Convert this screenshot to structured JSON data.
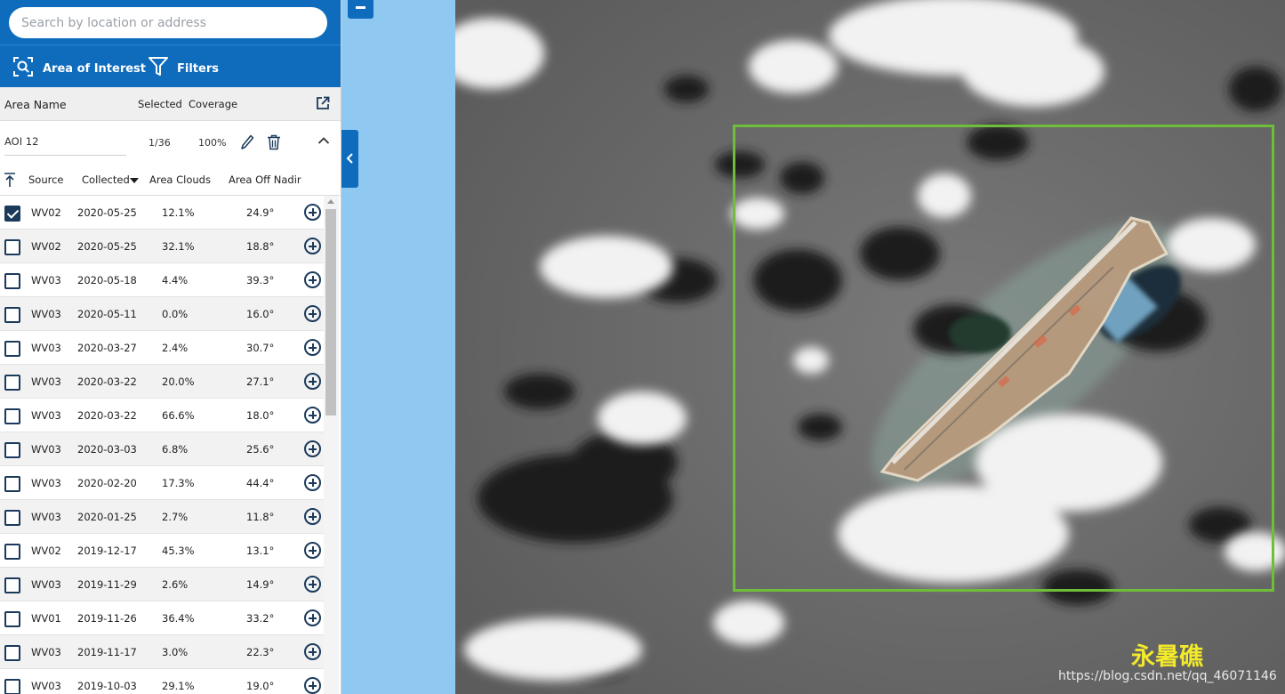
{
  "search": {
    "placeholder": "Search by location or address"
  },
  "toolbar": {
    "aoi_label": "Area of Interest",
    "filters_label": "Filters"
  },
  "area_header": {
    "name": "Area Name",
    "selected": "Selected",
    "coverage": "Coverage"
  },
  "aoi": {
    "name": "AOI 12",
    "selected": "1/36",
    "coverage": "100%"
  },
  "columns": {
    "source": "Source",
    "collected": "Collected",
    "clouds": "Area Clouds",
    "nadir": "Area Off Nadir"
  },
  "rows": [
    {
      "source": "WV02",
      "date": "2020-05-25",
      "clouds": "12.1%",
      "nadir": "24.9°",
      "checked": true
    },
    {
      "source": "WV02",
      "date": "2020-05-25",
      "clouds": "32.1%",
      "nadir": "18.8°",
      "checked": false
    },
    {
      "source": "WV03",
      "date": "2020-05-18",
      "clouds": "4.4%",
      "nadir": "39.3°",
      "checked": false
    },
    {
      "source": "WV03",
      "date": "2020-05-11",
      "clouds": "0.0%",
      "nadir": "16.0°",
      "checked": false
    },
    {
      "source": "WV03",
      "date": "2020-03-27",
      "clouds": "2.4%",
      "nadir": "30.7°",
      "checked": false
    },
    {
      "source": "WV03",
      "date": "2020-03-22",
      "clouds": "20.0%",
      "nadir": "27.1°",
      "checked": false
    },
    {
      "source": "WV03",
      "date": "2020-03-22",
      "clouds": "66.6%",
      "nadir": "18.0°",
      "checked": false
    },
    {
      "source": "WV03",
      "date": "2020-03-03",
      "clouds": "6.8%",
      "nadir": "25.6°",
      "checked": false
    },
    {
      "source": "WV03",
      "date": "2020-02-20",
      "clouds": "17.3%",
      "nadir": "44.4°",
      "checked": false
    },
    {
      "source": "WV03",
      "date": "2020-01-25",
      "clouds": "2.7%",
      "nadir": "11.8°",
      "checked": false
    },
    {
      "source": "WV02",
      "date": "2019-12-17",
      "clouds": "45.3%",
      "nadir": "13.1°",
      "checked": false
    },
    {
      "source": "WV03",
      "date": "2019-11-29",
      "clouds": "2.6%",
      "nadir": "14.9°",
      "checked": false
    },
    {
      "source": "WV01",
      "date": "2019-11-26",
      "clouds": "36.4%",
      "nadir": "33.2°",
      "checked": false
    },
    {
      "source": "WV03",
      "date": "2019-11-17",
      "clouds": "3.0%",
      "nadir": "22.3°",
      "checked": false
    },
    {
      "source": "WV03",
      "date": "2019-10-03",
      "clouds": "29.1%",
      "nadir": "19.0°",
      "checked": false
    }
  ],
  "map": {
    "place_label": "永暑礁",
    "watermark": "https://blog.csdn.net/qq_46071146"
  },
  "colors": {
    "brand": "#0f6cbd",
    "aoi_outline": "#6fbe3a",
    "label": "#f2ea2a"
  },
  "icons": [
    "aoi-target-icon",
    "filter-funnel-icon",
    "open-external-icon",
    "pencil-icon",
    "trash-icon",
    "chevron-up-icon",
    "sort-up-arrow-icon",
    "caret-down-icon",
    "add-circle-icon",
    "chevron-left-icon",
    "minus-icon"
  ]
}
